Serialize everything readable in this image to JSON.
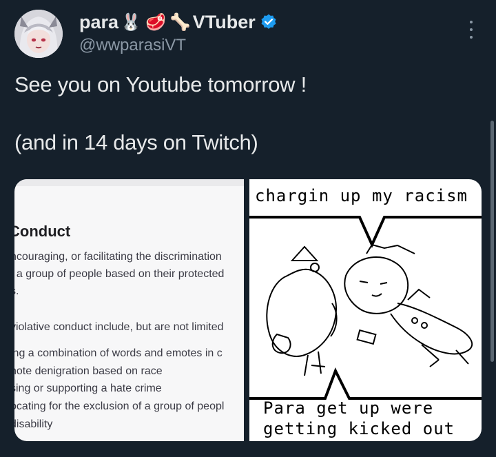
{
  "tweet": {
    "display_name": "para",
    "display_name_suffix": "VTuber",
    "name_emojis": [
      "🐰",
      "🥩",
      "🦴"
    ],
    "handle": "@wwparasiVT",
    "text": "See you on Youtube tomorrow !\n\n(and in 14 days on Twitch)",
    "verified_color": "#1d9bf0"
  },
  "media_left": {
    "heading": "Conduct",
    "lines": [
      "ncouraging, or facilitating the discrimination",
      "f a group of people based on their protected",
      "s.",
      "violative conduct include, but are not limited",
      "ing a combination of words and emotes in c",
      "note denigration based on race",
      "sing or supporting a hate crime",
      "ocating for the exclusion of a group of peopl",
      " disability"
    ]
  },
  "media_right": {
    "caption_top": "chargin up my racism",
    "caption_bottom_1": "Para get up were",
    "caption_bottom_2": "getting kicked out"
  }
}
